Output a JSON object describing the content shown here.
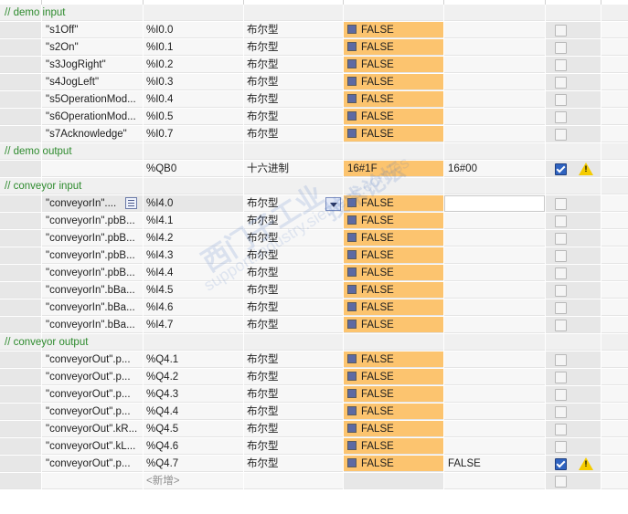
{
  "groups": [
    {
      "header": "// demo input",
      "rows": [
        {
          "name": "\"s1Off\"",
          "address": "%I0.0",
          "format": "布尔型",
          "monitor": "FALSE",
          "modify": "",
          "checked": false,
          "warning": false
        },
        {
          "name": "\"s2On\"",
          "address": "%I0.1",
          "format": "布尔型",
          "monitor": "FALSE",
          "modify": "",
          "checked": false,
          "warning": false
        },
        {
          "name": "\"s3JogRight\"",
          "address": "%I0.2",
          "format": "布尔型",
          "monitor": "FALSE",
          "modify": "",
          "checked": false,
          "warning": false
        },
        {
          "name": "\"s4JogLeft\"",
          "address": "%I0.3",
          "format": "布尔型",
          "monitor": "FALSE",
          "modify": "",
          "checked": false,
          "warning": false
        },
        {
          "name": "\"s5OperationMod...",
          "address": "%I0.4",
          "format": "布尔型",
          "monitor": "FALSE",
          "modify": "",
          "checked": false,
          "warning": false
        },
        {
          "name": "\"s6OperationMod...",
          "address": "%I0.5",
          "format": "布尔型",
          "monitor": "FALSE",
          "modify": "",
          "checked": false,
          "warning": false
        },
        {
          "name": "\"s7Acknowledge\"",
          "address": "%I0.7",
          "format": "布尔型",
          "monitor": "FALSE",
          "modify": "",
          "checked": false,
          "warning": false
        }
      ]
    },
    {
      "header": "// demo output",
      "rows": [
        {
          "name": "",
          "address": "%QB0",
          "format": "十六进制",
          "monitor": "16#1F",
          "modify": "16#00",
          "checked": true,
          "warning": true,
          "noBox": true
        }
      ]
    },
    {
      "header": "// conveyor input",
      "rows": [
        {
          "name": "\"conveyorIn\"....",
          "address": "%I4.0",
          "format": "布尔型",
          "monitor": "FALSE",
          "modify": "",
          "checked": false,
          "warning": false,
          "selected": true
        },
        {
          "name": "\"conveyorIn\".pbB...",
          "address": "%I4.1",
          "format": "布尔型",
          "monitor": "FALSE",
          "modify": "",
          "checked": false,
          "warning": false
        },
        {
          "name": "\"conveyorIn\".pbB...",
          "address": "%I4.2",
          "format": "布尔型",
          "monitor": "FALSE",
          "modify": "",
          "checked": false,
          "warning": false
        },
        {
          "name": "\"conveyorIn\".pbB...",
          "address": "%I4.3",
          "format": "布尔型",
          "monitor": "FALSE",
          "modify": "",
          "checked": false,
          "warning": false
        },
        {
          "name": "\"conveyorIn\".pbB...",
          "address": "%I4.4",
          "format": "布尔型",
          "monitor": "FALSE",
          "modify": "",
          "checked": false,
          "warning": false
        },
        {
          "name": "\"conveyorIn\".bBa...",
          "address": "%I4.5",
          "format": "布尔型",
          "monitor": "FALSE",
          "modify": "",
          "checked": false,
          "warning": false
        },
        {
          "name": "\"conveyorIn\".bBa...",
          "address": "%I4.6",
          "format": "布尔型",
          "monitor": "FALSE",
          "modify": "",
          "checked": false,
          "warning": false
        },
        {
          "name": "\"conveyorIn\".bBa...",
          "address": "%I4.7",
          "format": "布尔型",
          "monitor": "FALSE",
          "modify": "",
          "checked": false,
          "warning": false
        }
      ]
    },
    {
      "header": "// conveyor output",
      "rows": [
        {
          "name": "\"conveyorOut\".p...",
          "address": "%Q4.1",
          "format": "布尔型",
          "monitor": "FALSE",
          "modify": "",
          "checked": false,
          "warning": false
        },
        {
          "name": "\"conveyorOut\".p...",
          "address": "%Q4.2",
          "format": "布尔型",
          "monitor": "FALSE",
          "modify": "",
          "checked": false,
          "warning": false
        },
        {
          "name": "\"conveyorOut\".p...",
          "address": "%Q4.3",
          "format": "布尔型",
          "monitor": "FALSE",
          "modify": "",
          "checked": false,
          "warning": false
        },
        {
          "name": "\"conveyorOut\".p...",
          "address": "%Q4.4",
          "format": "布尔型",
          "monitor": "FALSE",
          "modify": "",
          "checked": false,
          "warning": false
        },
        {
          "name": "\"conveyorOut\".kR...",
          "address": "%Q4.5",
          "format": "布尔型",
          "monitor": "FALSE",
          "modify": "",
          "checked": false,
          "warning": false
        },
        {
          "name": "\"conveyorOut\".kL...",
          "address": "%Q4.6",
          "format": "布尔型",
          "monitor": "FALSE",
          "modify": "",
          "checked": false,
          "warning": false
        },
        {
          "name": "\"conveyorOut\".p...",
          "address": "%Q4.7",
          "format": "布尔型",
          "monitor": "FALSE",
          "modify": "FALSE",
          "checked": true,
          "warning": true
        }
      ]
    }
  ],
  "add_row_label": "<新增>",
  "warning_mark": "!",
  "watermark": {
    "line1": "西门子工业",
    "line2": "support.industry.siemens.com/cs",
    "line3": "技术论坛"
  },
  "colors": {
    "monitor_bg": "#fcc46f",
    "header_text": "#2e8b2e",
    "check_blue": "#2f63c0",
    "warning_yellow": "#f5cc00"
  }
}
